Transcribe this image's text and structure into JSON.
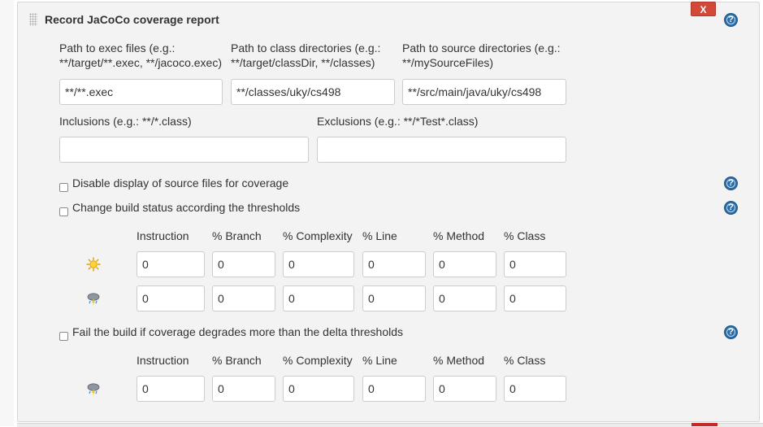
{
  "section": {
    "title": "Record JaCoCo coverage report",
    "delete_label": "X",
    "help_glyph": "?"
  },
  "paths": {
    "exec_label_1": "Path to exec files (e.g.:",
    "exec_label_2": "**/target/**.exec, **/jacoco.exec)",
    "exec_value": "**/**.exec",
    "class_label_1": "Path to class directories (e.g.:",
    "class_label_2": "**/target/classDir, **/classes)",
    "class_value": "**/classes/uky/cs498",
    "source_label_1": "Path to source directories (e.g.:",
    "source_label_2": "**/mySourceFiles)",
    "source_value": "**/src/main/java/uky/cs498",
    "inclusions_label": "Inclusions (e.g.: **/*.class)",
    "inclusions_value": "",
    "exclusions_label": "Exclusions (e.g.: **/*Test*.class)",
    "exclusions_value": ""
  },
  "options": {
    "disable_source_label": "Disable display of source files for coverage",
    "disable_source_checked": false,
    "change_status_label": "Change build status according the thresholds",
    "change_status_checked": false,
    "fail_delta_label": "Fail the build if coverage degrades more than the delta thresholds",
    "fail_delta_checked": false
  },
  "columns": [
    "Instruction",
    "% Branch",
    "% Complexity",
    "% Line",
    "% Method",
    "% Class"
  ],
  "thresholds": {
    "sunny_icon": "sunny-weather-icon",
    "stormy_icon": "stormy-weather-icon",
    "sunny": [
      "0",
      "0",
      "0",
      "0",
      "0",
      "0"
    ],
    "stormy": [
      "0",
      "0",
      "0",
      "0",
      "0",
      "0"
    ]
  },
  "delta": {
    "stormy": [
      "0",
      "0",
      "0",
      "0",
      "0",
      "0"
    ]
  },
  "colors": {
    "panel_bg": "#f3f3f3",
    "delete_red": "#d24939",
    "help_blue": "#2a6da8"
  }
}
